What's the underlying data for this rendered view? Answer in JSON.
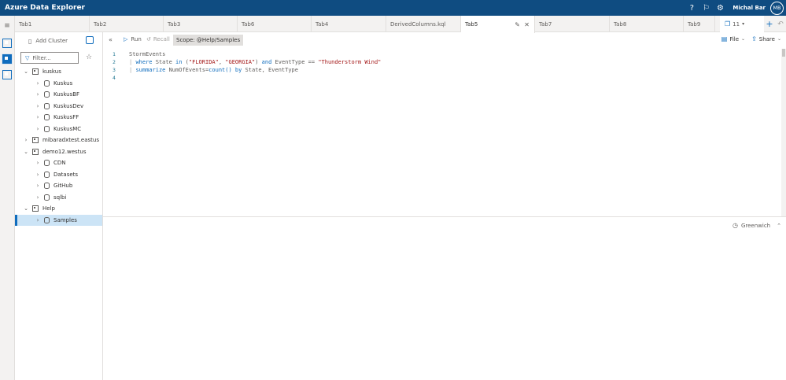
{
  "app": {
    "title": "Azure Data Explorer"
  },
  "header": {
    "help_icon": "question-icon",
    "feedback_icon": "feedback-icon",
    "settings_icon": "gear-icon",
    "user_name": "Michal Bar",
    "user_initials": "MB"
  },
  "tabs": {
    "items": [
      {
        "label": "Tab1"
      },
      {
        "label": "Tab2"
      },
      {
        "label": "Tab3"
      },
      {
        "label": "Tab6"
      },
      {
        "label": "Tab4"
      },
      {
        "label": "DerivedColumns.kql"
      },
      {
        "label": "Tab5"
      },
      {
        "label": "Tab7"
      },
      {
        "label": "Tab8"
      },
      {
        "label": "Tab9"
      }
    ],
    "active": "Tab5",
    "count": "11"
  },
  "left_panel": {
    "add_cluster_label": "Add Cluster",
    "filter_placeholder": "Filter...",
    "tree": [
      {
        "label": "kuskus",
        "type": "cluster",
        "expanded": true
      },
      {
        "label": "Kuskus",
        "type": "database"
      },
      {
        "label": "KuskusBF",
        "type": "database"
      },
      {
        "label": "KuskusDev",
        "type": "database"
      },
      {
        "label": "KuskusFF",
        "type": "database"
      },
      {
        "label": "KuskusMC",
        "type": "database"
      },
      {
        "label": "mibaradxtest.eastus",
        "type": "cluster",
        "expanded": false
      },
      {
        "label": "demo12.westus",
        "type": "cluster",
        "expanded": true
      },
      {
        "label": "CDN",
        "type": "database"
      },
      {
        "label": "Datasets",
        "type": "database"
      },
      {
        "label": "GitHub",
        "type": "database"
      },
      {
        "label": "sqlbi",
        "type": "database"
      },
      {
        "label": "Help",
        "type": "cluster",
        "expanded": true
      },
      {
        "label": "Samples",
        "type": "database",
        "selected": true
      }
    ]
  },
  "toolbar": {
    "run_label": "Run",
    "recall_label": "Recall",
    "scope_label": "Scope: @Help/Samples",
    "file_label": "File",
    "share_label": "Share"
  },
  "editor": {
    "line_numbers": [
      "1",
      "2",
      "3",
      "4"
    ],
    "line1": "StormEvents",
    "line2": {
      "pipe": "| ",
      "kw_where": "where",
      "t1": " State ",
      "kw_in": "in",
      "t2": " (",
      "s1": "\"FLORIDA\"",
      "t3": ", ",
      "s2": "\"GEORGIA\"",
      "t4": ") ",
      "kw_and": "and",
      "t5": " EventType == ",
      "s3": "\"Thunderstorm Wind\""
    },
    "line3": {
      "pipe": "| ",
      "kw_summarize": "summarize",
      "t1": " NumOfEvents=",
      "fn_count": "count()",
      "t2": " ",
      "kw_by": "by",
      "t3": " State, EventType"
    }
  },
  "results": {
    "timezone_label": "Greenwich"
  },
  "colors": {
    "header_bg": "#0f4c81",
    "accent": "#0f6cbd",
    "selected_row": "#cce4f6"
  }
}
